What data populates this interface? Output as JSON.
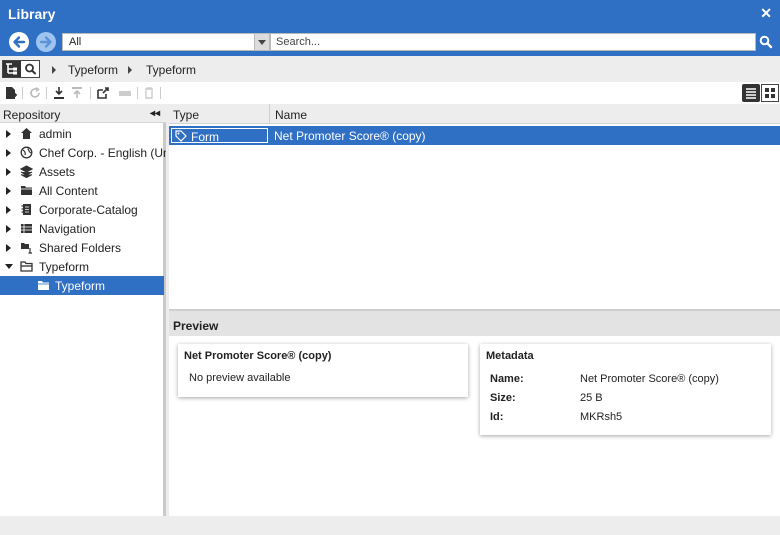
{
  "window": {
    "title": "Library",
    "close_label": "✕"
  },
  "nav": {
    "location_value": "All",
    "search_placeholder": "Search..."
  },
  "breadcrumb": [
    "Typeform",
    "Typeform"
  ],
  "sidebar": {
    "header": "Repository",
    "collapse_label": "◂◂",
    "items": [
      {
        "label": "admin",
        "icon": "home-icon"
      },
      {
        "label": "Chef Corp. - English (United",
        "icon": "globe-icon"
      },
      {
        "label": "Assets",
        "icon": "assets-icon"
      },
      {
        "label": "All Content",
        "icon": "folder-icon"
      },
      {
        "label": "Corporate-Catalog",
        "icon": "catalog-icon"
      },
      {
        "label": "Navigation",
        "icon": "navigation-icon"
      },
      {
        "label": "Shared Folders",
        "icon": "shared-folder-icon"
      },
      {
        "label": "Typeform",
        "icon": "open-folder-icon"
      },
      {
        "label": "Typeform",
        "icon": "folder-icon"
      }
    ]
  },
  "filelist": {
    "columns": {
      "type": "Type",
      "name": "Name"
    },
    "rows": [
      {
        "type": "Form",
        "name": "Net Promoter Score® (copy)"
      }
    ]
  },
  "preview": {
    "header": "Preview",
    "card_title": "Net Promoter Score® (copy)",
    "message": "No preview available",
    "metadata": {
      "title": "Metadata",
      "name_label": "Name:",
      "name_value": "Net Promoter Score® (copy)",
      "size_label": "Size:",
      "size_value": "25 B",
      "id_label": "Id:",
      "id_value": "MKRsh5"
    }
  },
  "colors": {
    "accent": "#2f6fc4",
    "panel": "#ededed"
  }
}
